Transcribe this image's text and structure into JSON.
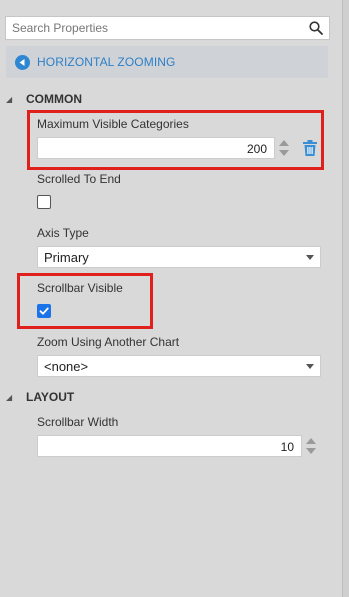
{
  "search": {
    "placeholder": "Search Properties",
    "icon": "search-icon"
  },
  "nav": {
    "back_icon": "back-arrow-icon",
    "title": "HORIZONTAL ZOOMING"
  },
  "sections": {
    "common": {
      "label": "COMMON",
      "expanded": true
    },
    "layout": {
      "label": "LAYOUT",
      "expanded": true
    }
  },
  "properties": {
    "max_visible_categories": {
      "label": "Maximum Visible Categories",
      "value": "200"
    },
    "scrolled_to_end": {
      "label": "Scrolled To End",
      "checked": false
    },
    "axis_type": {
      "label": "Axis Type",
      "value": "Primary"
    },
    "scrollbar_visible": {
      "label": "Scrollbar Visible",
      "checked": true
    },
    "zoom_using_another_chart": {
      "label": "Zoom Using Another Chart",
      "value": "<none>"
    },
    "scrollbar_width": {
      "label": "Scrollbar Width",
      "value": "10"
    }
  },
  "colors": {
    "accent": "#2e7fc6",
    "highlight": "#e0201d",
    "checkbox_checked": "#1a73e8",
    "trash": "#3a8fd4"
  }
}
